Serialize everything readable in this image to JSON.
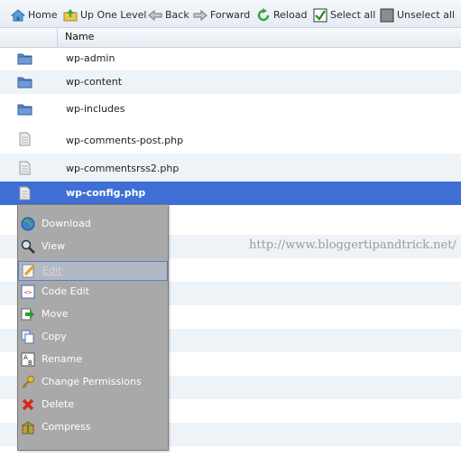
{
  "toolbar": {
    "items": [
      {
        "label": "Home",
        "icon": "home-icon"
      },
      {
        "label": "Up One Level",
        "icon": "up-one-level-icon"
      },
      {
        "label": "Back",
        "icon": "back-arrow-icon"
      },
      {
        "label": "Forward",
        "icon": "forward-arrow-icon"
      },
      {
        "label": "Reload",
        "icon": "reload-icon"
      },
      {
        "label": "Select all",
        "icon": "checked-box-icon"
      },
      {
        "label": "Unselect all",
        "icon": "unchecked-box-icon"
      }
    ]
  },
  "grid": {
    "header_name": "Name",
    "rows": [
      {
        "name": "wp-admin",
        "type": "folder"
      },
      {
        "name": "wp-content",
        "type": "folder"
      },
      {
        "name": "wp-includes",
        "type": "folder"
      },
      {
        "name": "wp-comments-post.php",
        "type": "file"
      },
      {
        "name": "wp-commentsrss2.php",
        "type": "file"
      },
      {
        "name": "wp-config.php",
        "type": "file",
        "selected": true
      }
    ]
  },
  "context_menu": {
    "items": [
      {
        "label": "Download",
        "icon": "globe-download-icon"
      },
      {
        "label": "View",
        "icon": "magnifier-icon"
      },
      {
        "label": "Edit",
        "icon": "edit-pencil-icon",
        "disabled": true
      },
      {
        "label": "Code Edit",
        "icon": "code-edit-icon"
      },
      {
        "label": "Move",
        "icon": "move-arrow-icon"
      },
      {
        "label": "Copy",
        "icon": "copy-icon"
      },
      {
        "label": "Rename",
        "icon": "rename-ab-icon"
      },
      {
        "label": "Change Permissions",
        "icon": "key-icon"
      },
      {
        "label": "Delete",
        "icon": "delete-x-icon"
      },
      {
        "label": "Compress",
        "icon": "compress-box-icon"
      }
    ]
  },
  "watermark": "http://www.bloggertipandtrick.net/",
  "colors": {
    "selection": "#3f6fd4",
    "menu_bg": "#a9a9a9",
    "alt_row": "#eef3f8"
  }
}
